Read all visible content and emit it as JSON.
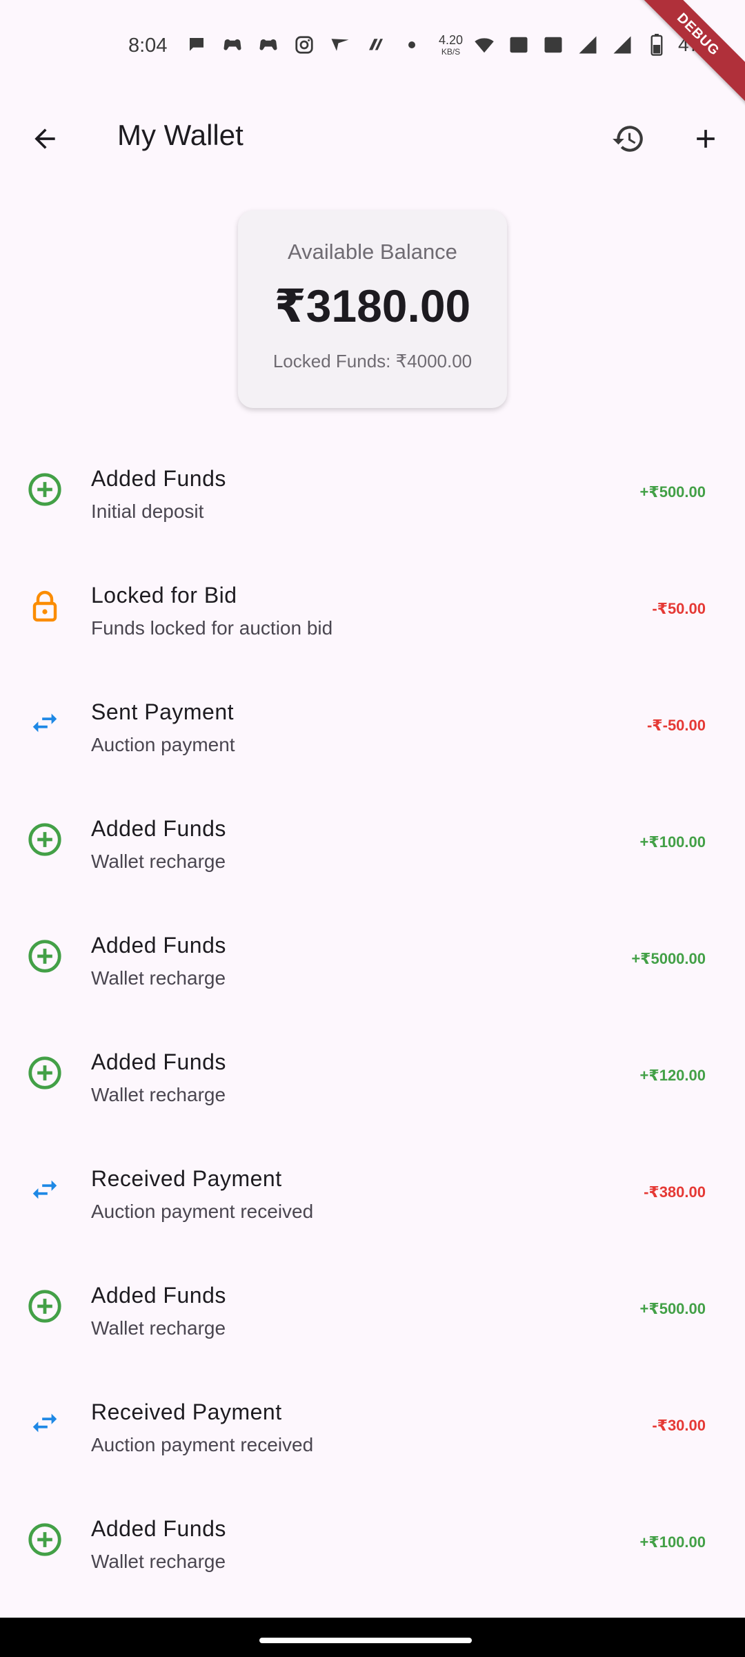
{
  "status_bar": {
    "time": "8:04",
    "net_speed": "4.20",
    "net_unit": "KB/S",
    "battery": "47%",
    "debug_label": "DEBUG"
  },
  "app_bar": {
    "title": "My Wallet",
    "icons": [
      "back-arrow-icon",
      "history-icon",
      "add-icon"
    ]
  },
  "balance": {
    "label": "Available Balance",
    "amount": "₹3180.00",
    "locked": "Locked Funds: ₹4000.00"
  },
  "colors": {
    "positive": "#43a047",
    "negative": "#e53935",
    "lock": "#fb8c00",
    "transfer": "#1e88e5"
  },
  "transactions": [
    {
      "icon": "add-circle-icon",
      "title": "Added Funds",
      "subtitle": "Initial deposit",
      "amount": "+₹500.00",
      "sign": "pos"
    },
    {
      "icon": "lock-icon",
      "title": "Locked for Bid",
      "subtitle": "Funds locked for auction bid",
      "amount": "-₹50.00",
      "sign": "neg"
    },
    {
      "icon": "swap-icon",
      "title": "Sent Payment",
      "subtitle": "Auction payment",
      "amount": "-₹-50.00",
      "sign": "neg"
    },
    {
      "icon": "add-circle-icon",
      "title": "Added Funds",
      "subtitle": "Wallet recharge",
      "amount": "+₹100.00",
      "sign": "pos"
    },
    {
      "icon": "add-circle-icon",
      "title": "Added Funds",
      "subtitle": "Wallet recharge",
      "amount": "+₹5000.00",
      "sign": "pos"
    },
    {
      "icon": "add-circle-icon",
      "title": "Added Funds",
      "subtitle": "Wallet recharge",
      "amount": "+₹120.00",
      "sign": "pos"
    },
    {
      "icon": "swap-icon",
      "title": "Received Payment",
      "subtitle": "Auction payment received",
      "amount": "-₹380.00",
      "sign": "neg"
    },
    {
      "icon": "add-circle-icon",
      "title": "Added Funds",
      "subtitle": "Wallet recharge",
      "amount": "+₹500.00",
      "sign": "pos"
    },
    {
      "icon": "swap-icon",
      "title": "Received Payment",
      "subtitle": "Auction payment received",
      "amount": "-₹30.00",
      "sign": "neg"
    },
    {
      "icon": "add-circle-icon",
      "title": "Added Funds",
      "subtitle": "Wallet recharge",
      "amount": "+₹100.00",
      "sign": "pos"
    }
  ]
}
